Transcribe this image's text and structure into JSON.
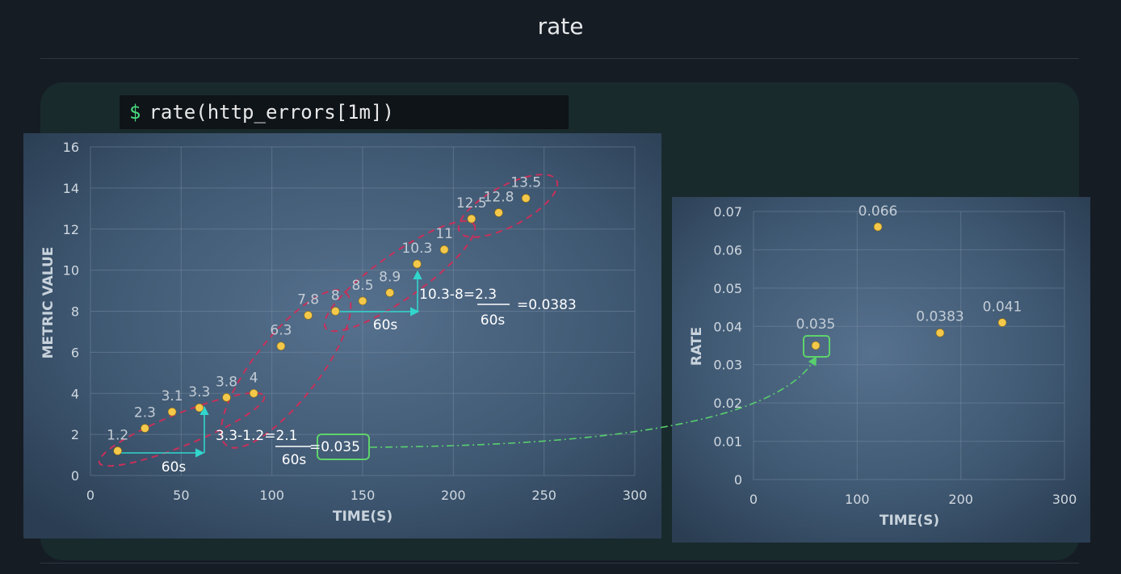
{
  "page": {
    "title": "rate"
  },
  "command": {
    "prompt": "$",
    "text": "rate(http_errors[1m])"
  },
  "colors": {
    "point": "#f4c84a",
    "ellipse": "#c7305a",
    "arrow": "#31d6cc",
    "highlight": "#5fd36b",
    "curve": "#58cf6e"
  },
  "chart_data": [
    {
      "type": "scatter",
      "title": "",
      "xlabel": "TIME(S)",
      "ylabel": "METRIC VALUE",
      "xlim": [
        0,
        300
      ],
      "ylim": [
        0,
        16
      ],
      "xticks": [
        "0",
        "50",
        "100",
        "150",
        "200",
        "250",
        "300"
      ],
      "yticks": [
        "0",
        "2",
        "4",
        "6",
        "8",
        "10",
        "12",
        "14",
        "16"
      ],
      "grid": true,
      "x": [
        15,
        30,
        45,
        60,
        75,
        90,
        105,
        120,
        135,
        150,
        165,
        180,
        195,
        210,
        225,
        240
      ],
      "y": [
        1.2,
        2.3,
        3.1,
        3.3,
        3.8,
        4,
        6.3,
        7.8,
        8,
        8.5,
        8.9,
        10.3,
        11,
        12.5,
        12.8,
        13.5
      ],
      "labels": [
        "1.2",
        "2.3",
        "3.1",
        "3.3",
        "3.8",
        "4",
        "6.3",
        "7.8",
        "8",
        "8.5",
        "8.9",
        "10.3",
        "11",
        "12.5",
        "12.8",
        "13.5"
      ],
      "annotations": {
        "first_numerator": "3.3-1.2=2.1",
        "first_denominator": "60s",
        "first_result": "=0.035",
        "first_span": "60s",
        "second_numerator": "10.3-8=2.3",
        "second_denominator": "60s",
        "second_result": "=0.0383",
        "second_span": "60s"
      }
    },
    {
      "type": "scatter",
      "title": "",
      "xlabel": "TIME(S)",
      "ylabel": "RATE",
      "xlim": [
        0,
        300
      ],
      "ylim": [
        0,
        0.07
      ],
      "xticks": [
        "0",
        "100",
        "200",
        "300"
      ],
      "yticks": [
        "0",
        "0.01",
        "0.02",
        "0.03",
        "0.04",
        "0.05",
        "0.06",
        "0.07"
      ],
      "grid": true,
      "x": [
        60,
        120,
        180,
        240
      ],
      "y": [
        0.035,
        0.066,
        0.0383,
        0.041
      ],
      "labels": [
        "0.035",
        "0.066",
        "0.0383",
        "0.041"
      ]
    }
  ]
}
